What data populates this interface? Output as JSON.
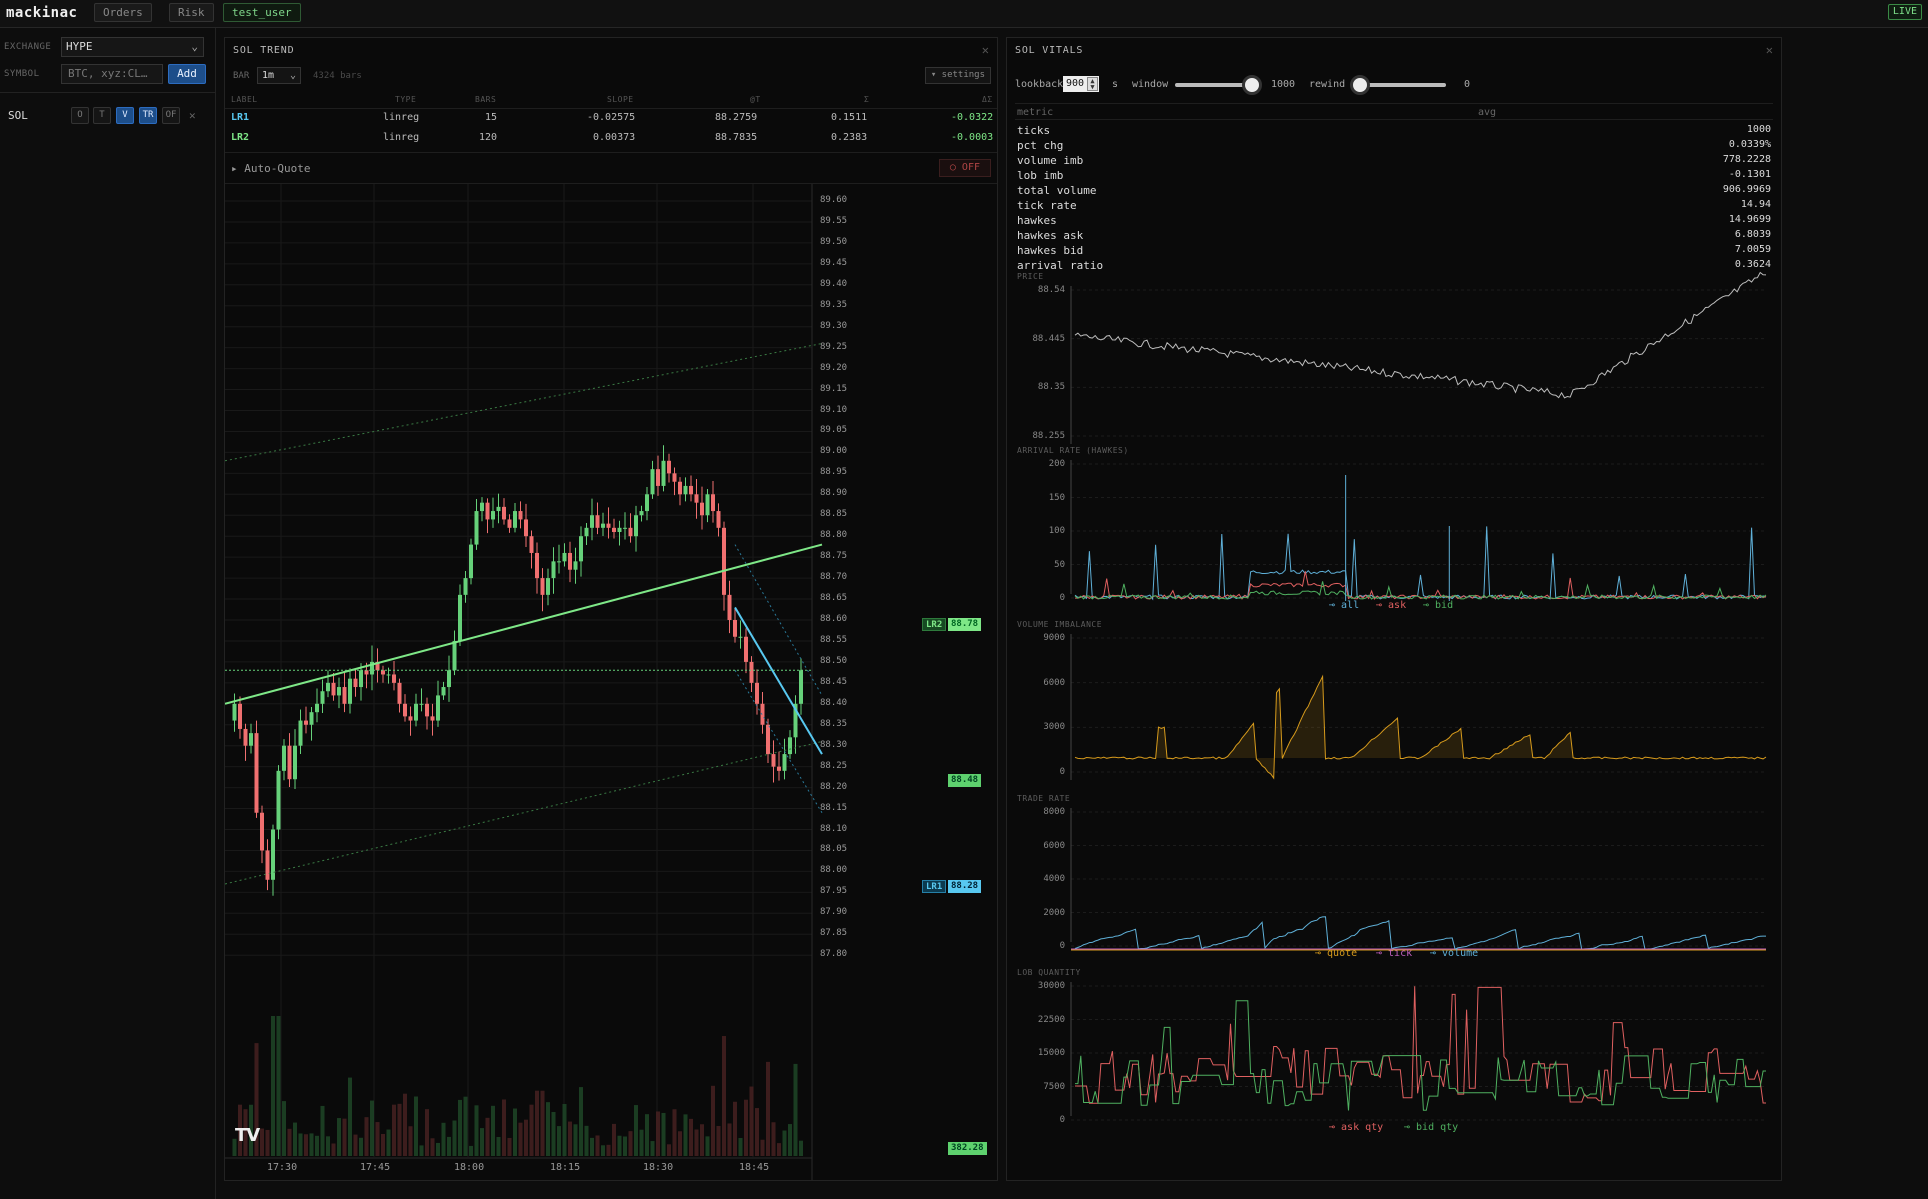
{
  "topbar": {
    "brand": "mackinac",
    "tabs": [
      "Orders",
      "Risk"
    ],
    "user": "test_user",
    "live": "LIVE"
  },
  "sidebar": {
    "exchange_label": "EXCHANGE",
    "exchange_value": "HYPE",
    "symbol_label": "SYMBOL",
    "symbol_placeholder": "BTC, xyz:CL…",
    "add_label": "Add",
    "watch_symbol": "SOL",
    "chips": [
      "O",
      "T",
      "V",
      "TR",
      "OF"
    ],
    "chips_active": [
      "V",
      "TR"
    ]
  },
  "trend": {
    "title": "SOL TREND",
    "bar_label": "BAR",
    "bar_value": "1m",
    "bars_count": "4324 bars",
    "settings": "▾ settings",
    "columns": [
      "LABEL",
      "TYPE",
      "BARS",
      "SLOPE",
      "@T",
      "Σ",
      "ΔΣ"
    ],
    "rows": [
      {
        "label": "LR1",
        "type": "linreg",
        "bars": "15",
        "slope": "-0.02575",
        "at": "88.2759",
        "sigma": "0.1511",
        "dsigma": "-0.0322"
      },
      {
        "label": "LR2",
        "type": "linreg",
        "bars": "120",
        "slope": "0.00373",
        "at": "88.7835",
        "sigma": "0.2383",
        "dsigma": "-0.0003"
      }
    ],
    "autoquote": "▸ Auto-Quote",
    "off": "○ OFF",
    "price_axis": [
      "89.60",
      "89.55",
      "89.50",
      "89.45",
      "89.40",
      "89.35",
      "89.30",
      "89.25",
      "89.20",
      "89.15",
      "89.10",
      "89.05",
      "89.00",
      "88.95",
      "88.90",
      "88.85",
      "88.80",
      "88.75",
      "88.70",
      "88.65",
      "88.60",
      "88.55",
      "88.50",
      "88.45",
      "88.40",
      "88.35",
      "88.30",
      "88.25",
      "88.20",
      "88.15",
      "88.10",
      "88.05",
      "88.00",
      "87.95",
      "87.90",
      "87.85",
      "87.80"
    ],
    "time_axis": [
      "17:30",
      "17:45",
      "18:00",
      "18:15",
      "18:30",
      "18:45"
    ],
    "tags": {
      "lr2_name": "LR2",
      "lr2_value": "88.78",
      "last_value": "88.48",
      "lr1_name": "LR1",
      "lr1_value": "88.28",
      "volume_value": "382.28"
    },
    "watermark": "TV"
  },
  "vitals": {
    "title": "SOL VITALS",
    "controls": {
      "lookback_label": "lookback",
      "lookback_value": "900",
      "unit": "s",
      "window_label": "window",
      "window_value": "1000",
      "window_fraction": 0.9,
      "rewind_label": "rewind",
      "rewind_value": "0",
      "rewind_fraction": 0.0
    },
    "metrics_header": [
      "metric",
      "avg"
    ],
    "metrics": [
      {
        "name": "ticks",
        "value": "1000"
      },
      {
        "name": "pct chg",
        "value": "0.0339%"
      },
      {
        "name": "volume imb",
        "value": "778.2228"
      },
      {
        "name": "lob imb",
        "value": "-0.1301"
      },
      {
        "name": "total volume",
        "value": "906.9969"
      },
      {
        "name": "tick rate",
        "value": "14.94"
      },
      {
        "name": "hawkes",
        "value": "14.9699"
      },
      {
        "name": "hawkes ask",
        "value": "6.8039"
      },
      {
        "name": "hawkes bid",
        "value": "7.0059"
      },
      {
        "name": "arrival ratio",
        "value": "0.3624"
      }
    ],
    "charts": {
      "price": {
        "title": "PRICE",
        "ticks": [
          "88.54",
          "88.445",
          "88.35",
          "88.255"
        ]
      },
      "arrival": {
        "title": "ARRIVAL RATE (HAWKES)",
        "ticks": [
          "200",
          "150",
          "100",
          "50",
          "0"
        ],
        "legend": [
          "all",
          "ask",
          "bid"
        ]
      },
      "volimb": {
        "title": "VOLUME IMBALANCE",
        "ticks": [
          "9000",
          "6000",
          "3000",
          "0"
        ]
      },
      "trade": {
        "title": "TRADE RATE",
        "ticks": [
          "8000",
          "6000",
          "4000",
          "2000",
          "0"
        ],
        "legend": [
          "quote",
          "tick",
          "volume"
        ]
      },
      "lob": {
        "title": "LOB QUANTITY",
        "ticks": [
          "30000",
          "22500",
          "15000",
          "7500",
          "0"
        ],
        "legend": [
          "ask qty",
          "bid qty"
        ]
      }
    }
  },
  "colors": {
    "up": "#66d17a",
    "down": "#f07070",
    "lr2": "#7ee787",
    "lr1": "#58c8f0",
    "orange": "#d69a1c",
    "blue": "#5fb0d8",
    "red": "#e06060",
    "green": "#4fb060",
    "pink": "#c060c0"
  }
}
